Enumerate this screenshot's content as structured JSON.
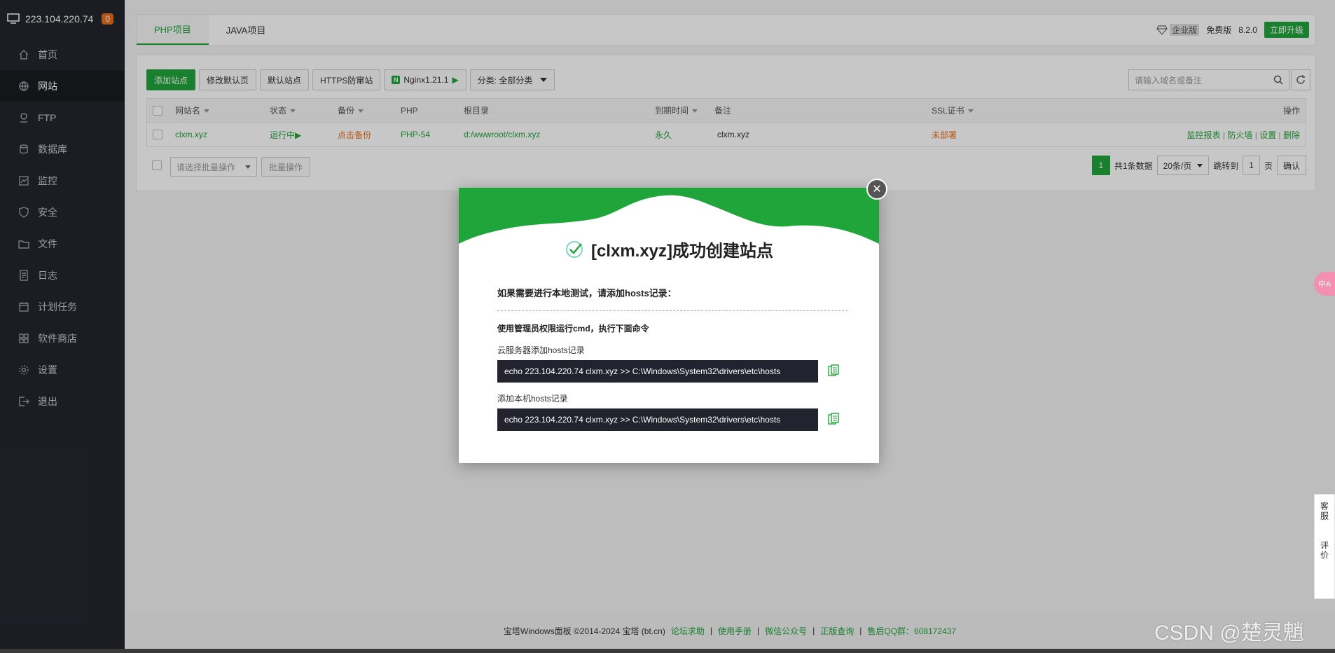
{
  "sidebar": {
    "ip": "223.104.220.74",
    "badge": "0",
    "items": [
      {
        "label": "首页",
        "icon": "home-icon"
      },
      {
        "label": "网站",
        "icon": "globe-icon"
      },
      {
        "label": "FTP",
        "icon": "ftp-icon"
      },
      {
        "label": "数据库",
        "icon": "database-icon"
      },
      {
        "label": "监控",
        "icon": "monitor-icon"
      },
      {
        "label": "安全",
        "icon": "shield-icon"
      },
      {
        "label": "文件",
        "icon": "folder-icon"
      },
      {
        "label": "日志",
        "icon": "log-icon"
      },
      {
        "label": "计划任务",
        "icon": "calendar-icon"
      },
      {
        "label": "软件商店",
        "icon": "grid-icon"
      },
      {
        "label": "设置",
        "icon": "gear-icon"
      },
      {
        "label": "退出",
        "icon": "logout-icon"
      }
    ]
  },
  "tabs": [
    "PHP项目",
    "JAVA项目"
  ],
  "header": {
    "edition": "企业版",
    "free": "免费版",
    "version": "8.2.0",
    "upgrade": "立即升级"
  },
  "toolbar": {
    "add_site": "添加站点",
    "default_page": "修改默认页",
    "default_site": "默认站点",
    "https": "HTTPS防窜站",
    "nginx": "Nginx1.21.1",
    "category": "分类: 全部分类",
    "search_placeholder": "请输入域名或备注"
  },
  "table": {
    "headers": {
      "name": "网站名",
      "status": "状态",
      "backup": "备份",
      "php": "PHP",
      "root": "根目录",
      "expire": "到期时间",
      "remark": "备注",
      "ssl": "SSL证书",
      "ops": "操作"
    },
    "rows": [
      {
        "name": "clxm.xyz",
        "status": "运行中▶",
        "backup": "点击备份",
        "php": "PHP-54",
        "root": "d:/wwwroot/clxm.xyz",
        "expire": "永久",
        "remark": "clxm.xyz",
        "ssl": "未部署",
        "op1": "监控报表",
        "op2": "防火墙",
        "op3": "设置",
        "op4": "删除"
      }
    ]
  },
  "footer_bar": {
    "batch_select": "请选择批量操作",
    "batch_btn": "批量操作",
    "page": "1",
    "total": "共1条数据",
    "per_page": "20条/页",
    "jump": "跳转到",
    "jump_value": "1",
    "page_unit": "页",
    "confirm": "确认"
  },
  "modal": {
    "title": "[clxm.xyz]成功创建站点",
    "line1": "如果需要进行本地测试，请添加hosts记录：",
    "line2": "使用管理员权限运行cmd，执行下面命令",
    "label1": "云服务器添加hosts记录",
    "cmd1": "echo 223.104.220.74 clxm.xyz >> C:\\Windows\\System32\\drivers\\etc\\hosts",
    "label2": "添加本机hosts记录",
    "cmd2": "echo 223.104.220.74 clxm.xyz >> C:\\Windows\\System32\\drivers\\etc\\hosts",
    "accent": "#20a53a"
  },
  "page_footer": {
    "copyright": "宝塔Windows面板 ©2014-2024 宝塔 (bt.cn)",
    "links": [
      "论坛求助",
      "使用手册",
      "微信公众号",
      "正版查询"
    ],
    "qq": "售后QQ群：608172437"
  },
  "side_tools": {
    "service": "客服",
    "review": "评价",
    "pink": "中A"
  },
  "watermark": "CSDN @楚灵魈"
}
